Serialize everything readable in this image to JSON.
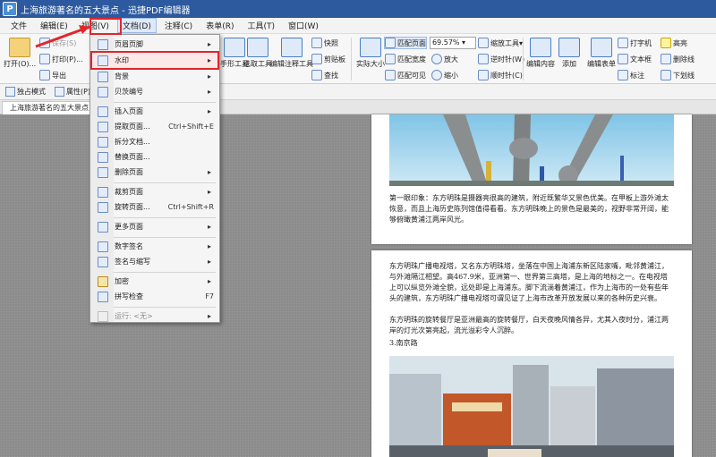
{
  "window": {
    "title": "上海旅游著名的五大景点 - 迅捷PDF编辑器",
    "app_icon_letter": "P"
  },
  "menubar": {
    "items": [
      "文件",
      "编辑(E)",
      "视图(V)",
      "文档(D)",
      "注释(C)",
      "表单(R)",
      "工具(T)",
      "窗口(W)"
    ],
    "active": "文档(D)"
  },
  "ribbon": {
    "open_label": "打开(O)...",
    "save_label": "保存(S)",
    "print_label": "打印(P)...",
    "export_label": "导出",
    "zoom_value": "69.57%",
    "buttons": {
      "snapshot": "快照",
      "clipboard": "剪贴板",
      "find": "查找",
      "actual_size": "实际大小",
      "fit_page": "匹配页面",
      "fit_width": "匹配宽度",
      "fit_visible": "匹配可见",
      "zoom_tool": "缩放工具",
      "zoom_in": "放大",
      "zoom_out": "缩小",
      "rotate_ccw": "逆时针(W)",
      "rotate_cw": "顺时针(C)",
      "edit_content": "编辑内容",
      "add": "添加",
      "edit_form": "编辑表单",
      "typewriter": "打字机",
      "textbox": "文本框",
      "callout": "标注",
      "highlight": "高亮",
      "strikeout": "删除线",
      "underline": "下划线",
      "hand_tool": "手形工具",
      "select_tool": "选取工具",
      "edit_annot_tool": "编辑注释工具"
    }
  },
  "toolbar2": {
    "exclusive_mode": "独占模式",
    "properties": "属性(P)..."
  },
  "tab": {
    "document_name": "上海旅游著名的五大景点"
  },
  "doc_menu": {
    "items": [
      {
        "label": "页眉页脚",
        "arrow": true
      },
      {
        "label": "水印",
        "arrow": true,
        "highlighted": true
      },
      {
        "label": "背景",
        "arrow": true
      },
      {
        "label": "贝茨编号",
        "arrow": true
      },
      {
        "label": "插入页面",
        "arrow": true
      },
      {
        "label": "提取页面...",
        "shortcut": "Ctrl+Shift+E"
      },
      {
        "label": "拆分文档..."
      },
      {
        "label": "替换页面..."
      },
      {
        "label": "删除页面",
        "arrow": true
      },
      {
        "label": "裁剪页面",
        "arrow": true
      },
      {
        "label": "旋转页面...",
        "shortcut": "Ctrl+Shift+R"
      },
      {
        "label": "更多页面",
        "arrow": true
      },
      {
        "label": "数字签名",
        "arrow": true
      },
      {
        "label": "签名与缩写",
        "arrow": true
      },
      {
        "label": "加密",
        "arrow": true
      },
      {
        "label": "拼写检查",
        "shortcut": "F7"
      },
      {
        "label": "运行: <无>",
        "arrow": true,
        "disabled": true
      }
    ]
  },
  "page_content": {
    "para1": "第一眼印象：东方明珠是摄器亮很高的建筑，附近既繁华又景色优美。在甲板上游外滩太恢意，而且上海历史陈列馆值得看看。东方明珠晚上的景色是最美的，视野非常开阔，能够俯瞰黄浦江两岸风光。",
    "para2": "东方明珠广播电视塔，又名东方明珠塔，坐落在中国上海浦东新区陆家嘴，毗邻黄浦江，与外滩隔江相望。高467.9米，亚洲第一、世界第三高塔，是上海的地标之一。在电视塔上可以纵览外滩全貌，远处即是上海浦东。脚下流淌着黄浦江，作为上海市的一处有些年头的建筑，东方明珠广播电视塔可谓见证了上海市改革开放发展以来的各种历史兴衰。",
    "para3": "东方明珠的旋转餐厅是亚洲最高的旋转餐厅，白天夜晚风情各异，尤其入夜时分，浦江两岸的灯光次第亮起，流光溢彩令人沉醉。",
    "heading3": "3.南京路"
  },
  "colors": {
    "title_bar": "#2d5a9e",
    "highlight_red": "#e0262c",
    "workspace": "#8d8d8d"
  }
}
